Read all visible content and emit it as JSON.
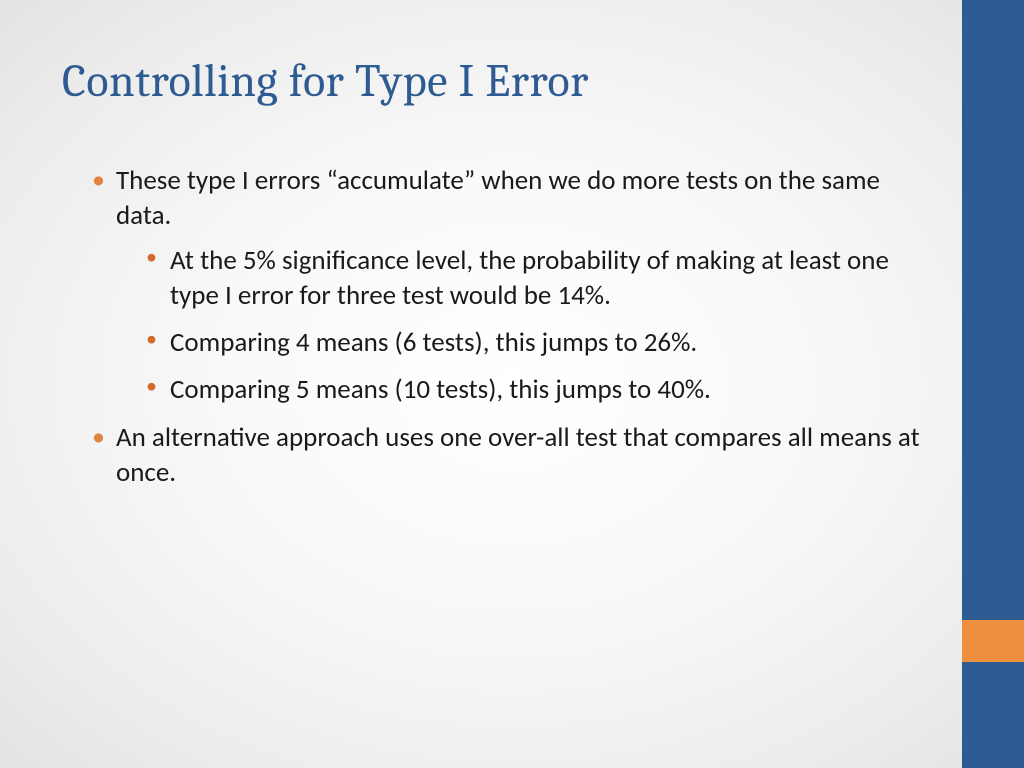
{
  "title": "Controlling for Type I Error",
  "bullets": {
    "item1": "These type I errors “accumulate” when we do more tests on the same data.",
    "sub1": "At the 5% significance level, the probability of making at least one type I error for three test would be 14%.",
    "sub2": "Comparing 4 means (6 tests), this jumps to 26%.",
    "sub3": "Comparing 5 means (10 tests), this jumps to 40%.",
    "item2": "An alternative approach uses one over-all test that compares all means at once."
  }
}
